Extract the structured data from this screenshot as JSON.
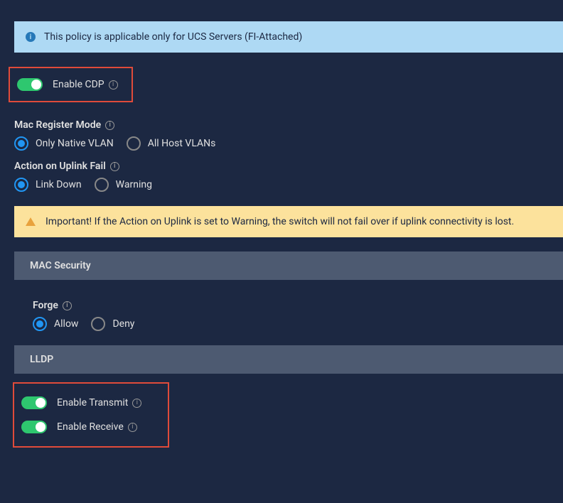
{
  "infoBanner": {
    "text": "This policy is applicable only for UCS Servers (FI-Attached)"
  },
  "enableCdp": {
    "label": "Enable CDP"
  },
  "macRegisterMode": {
    "label": "Mac Register Mode",
    "options": {
      "nativeVlan": "Only Native VLAN",
      "allHostVlans": "All Host VLANs"
    }
  },
  "actionOnUplinkFail": {
    "label": "Action on Uplink Fail",
    "options": {
      "linkDown": "Link Down",
      "warning": "Warning"
    }
  },
  "warningBanner": {
    "text": "Important! If the Action on Uplink is set to Warning, the switch will not fail over if uplink connectivity is lost."
  },
  "macSecurity": {
    "header": "MAC Security",
    "forge": {
      "label": "Forge",
      "options": {
        "allow": "Allow",
        "deny": "Deny"
      }
    }
  },
  "lldp": {
    "header": "LLDP",
    "enableTransmit": "Enable Transmit",
    "enableReceive": "Enable Receive"
  }
}
